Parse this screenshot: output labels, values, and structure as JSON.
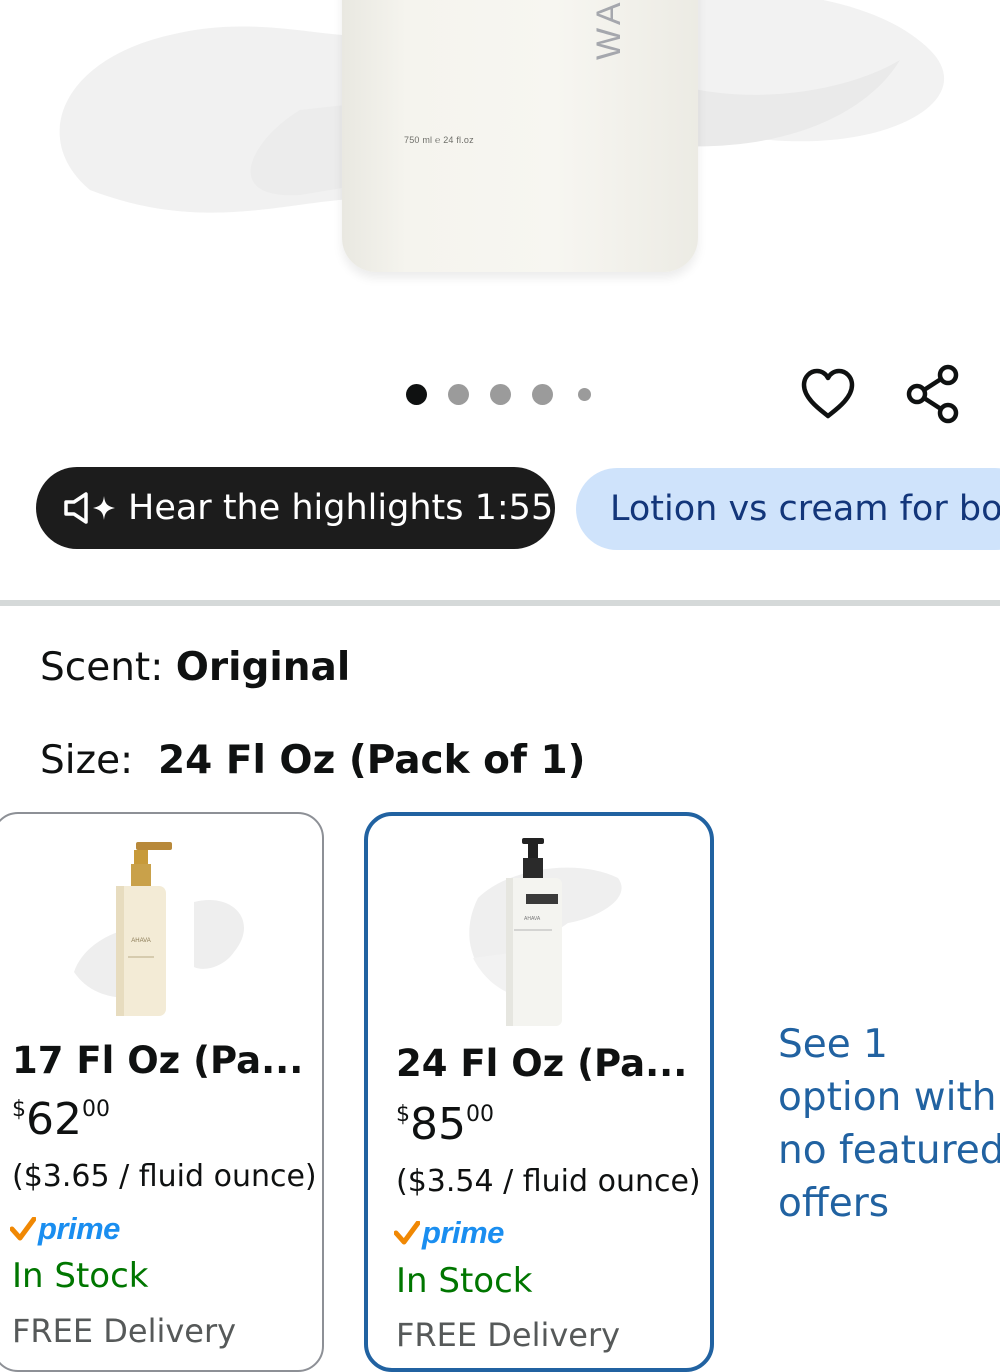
{
  "hero": {
    "bottle_volume_text": "750 ml ℮ 24 fl.oz",
    "bottle_brand_fragment": "WA"
  },
  "carousel": {
    "dot_count": 5,
    "active_index": 0
  },
  "actions": {
    "wishlist_icon": "heart-icon",
    "share_icon": "share-icon"
  },
  "chips": {
    "audio_label": "Hear the highlights 1:55",
    "audio_icon": "speaker-sparkle-icon",
    "question_label": "Lotion vs cream for bo"
  },
  "variations": {
    "scent_label": "Scent:",
    "scent_value": "Original",
    "size_label": "Size:",
    "size_value": "24 Fl Oz (Pack of 1)"
  },
  "size_options": [
    {
      "title": "17 Fl Oz (Pa...",
      "price_symbol": "$",
      "price_whole": "62",
      "price_fraction": "00",
      "unit_price": "($3.65 / fluid ounce)",
      "prime": "prime",
      "stock": "In Stock",
      "delivery": "FREE Delivery",
      "selected": false
    },
    {
      "title": "24 Fl Oz (Pa...",
      "price_symbol": "$",
      "price_whole": "85",
      "price_fraction": "00",
      "unit_price": "($3.54 / fluid ounce)",
      "prime": "prime",
      "stock": "In Stock",
      "delivery": "FREE Delivery",
      "selected": true
    }
  ],
  "see_more_link": "See 1 option with no featured offers",
  "colors": {
    "link_blue": "#2162a1",
    "stock_green": "#007600",
    "prime_blue": "#1a8ef0",
    "prime_check": "#f08804",
    "chip_dark": "#1c1c1c",
    "chip_light": "#cfe3fb"
  }
}
